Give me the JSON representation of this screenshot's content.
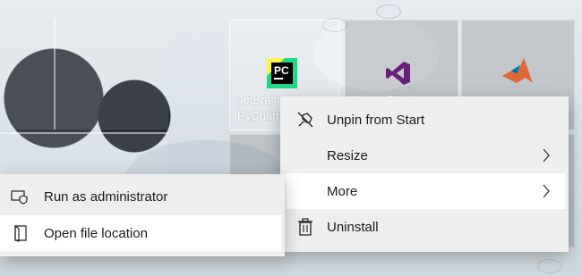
{
  "tiles": {
    "pycharm": {
      "label_line1": "JetBrains",
      "label_line2": "PyCharm",
      "icon_text": "PC",
      "brand_color": "#21d789"
    },
    "visual_studio": {
      "label": "Visual Studio",
      "brand_color": "#68217a"
    },
    "matlab": {
      "brand_color": "#e16737"
    }
  },
  "context_menu": {
    "items": [
      {
        "label": "Unpin from Start",
        "icon": "unpin-icon"
      },
      {
        "label": "Resize",
        "icon": "",
        "has_submenu": true
      },
      {
        "label": "More",
        "icon": "",
        "has_submenu": true,
        "highlighted": true
      },
      {
        "label": "Uninstall",
        "icon": "trash-icon"
      }
    ]
  },
  "submenu": {
    "items": [
      {
        "label": "Run as administrator",
        "icon": "shield-icon"
      },
      {
        "label": "Open file location",
        "icon": "folder-icon",
        "highlighted": true
      }
    ]
  }
}
